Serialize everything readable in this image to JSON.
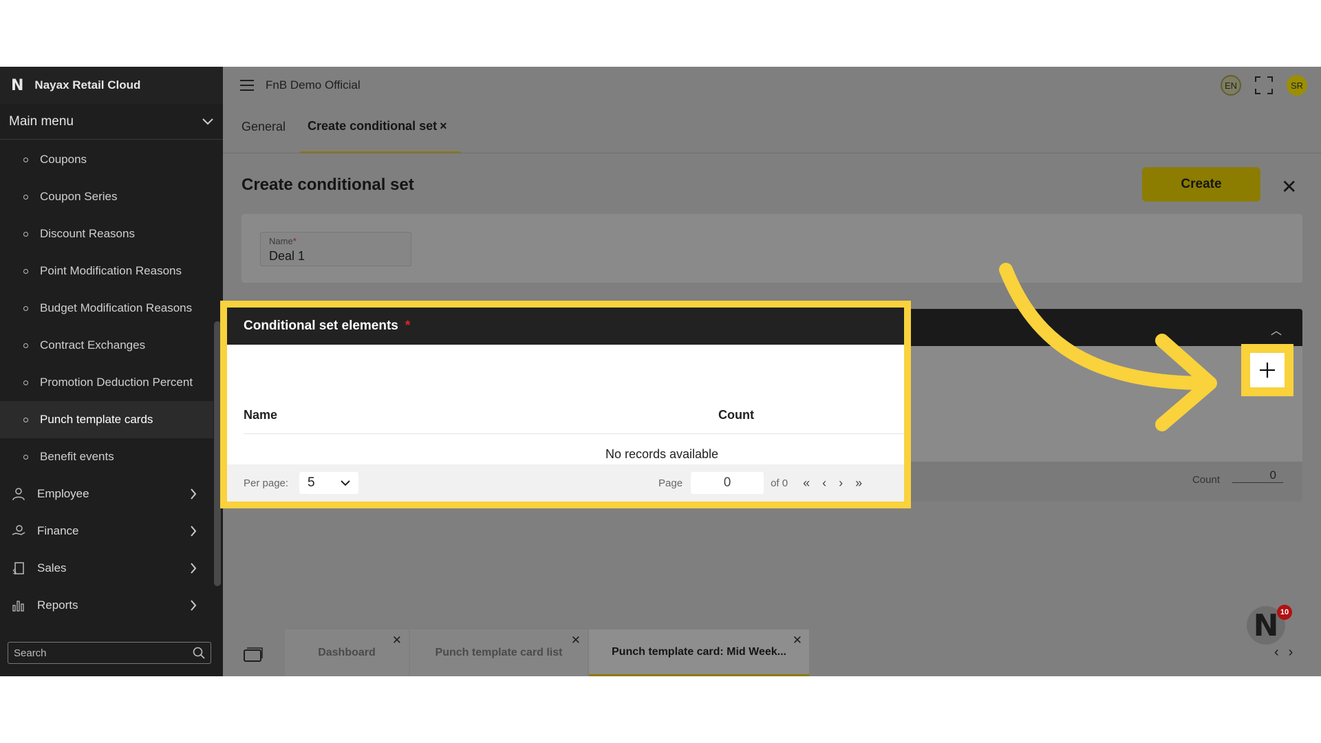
{
  "sidebar": {
    "brand": "Nayax Retail Cloud",
    "main_menu_label": "Main menu",
    "sub_items": [
      {
        "label": "Coupons"
      },
      {
        "label": "Coupon Series"
      },
      {
        "label": "Discount Reasons"
      },
      {
        "label": "Point Modification Reasons"
      },
      {
        "label": "Budget Modification Reasons"
      },
      {
        "label": "Contract Exchanges"
      },
      {
        "label": "Promotion Deduction Percent"
      },
      {
        "label": "Punch template cards",
        "active": true
      },
      {
        "label": "Benefit events"
      }
    ],
    "sections": [
      {
        "label": "Employee",
        "icon": "employee-icon"
      },
      {
        "label": "Finance",
        "icon": "finance-icon"
      },
      {
        "label": "Sales",
        "icon": "sales-icon"
      },
      {
        "label": "Reports",
        "icon": "reports-icon"
      }
    ],
    "search_placeholder": "Search"
  },
  "topbar": {
    "title": "FnB Demo Official",
    "language": "EN",
    "user_initials": "SR"
  },
  "tabs": [
    {
      "label": "General"
    },
    {
      "label": "Create conditional set",
      "active": true
    }
  ],
  "page": {
    "title": "Create conditional set",
    "create_label": "Create"
  },
  "form": {
    "name_label": "Name",
    "name_required": "*",
    "name_value": "Deal 1"
  },
  "elements_panel": {
    "title": "Conditional set elements",
    "required_mark": "*",
    "columns": [
      "Name",
      "Count"
    ],
    "empty_text": "No records available",
    "per_page_label": "Per page:",
    "per_page_value": "5",
    "page_label": "Page",
    "page_value": "0",
    "page_of": "of 0",
    "count_label": "Count",
    "count_value": "0"
  },
  "bottom_tabs": [
    {
      "label": "Dashboard"
    },
    {
      "label": "Punch template card list"
    },
    {
      "label": "Punch template card: Mid Week...",
      "active": true
    }
  ],
  "notification_count": "10",
  "colors": {
    "highlight": "#f9d23c",
    "accent": "#8c7c00",
    "sidebar_bg": "#1e1e1e"
  }
}
